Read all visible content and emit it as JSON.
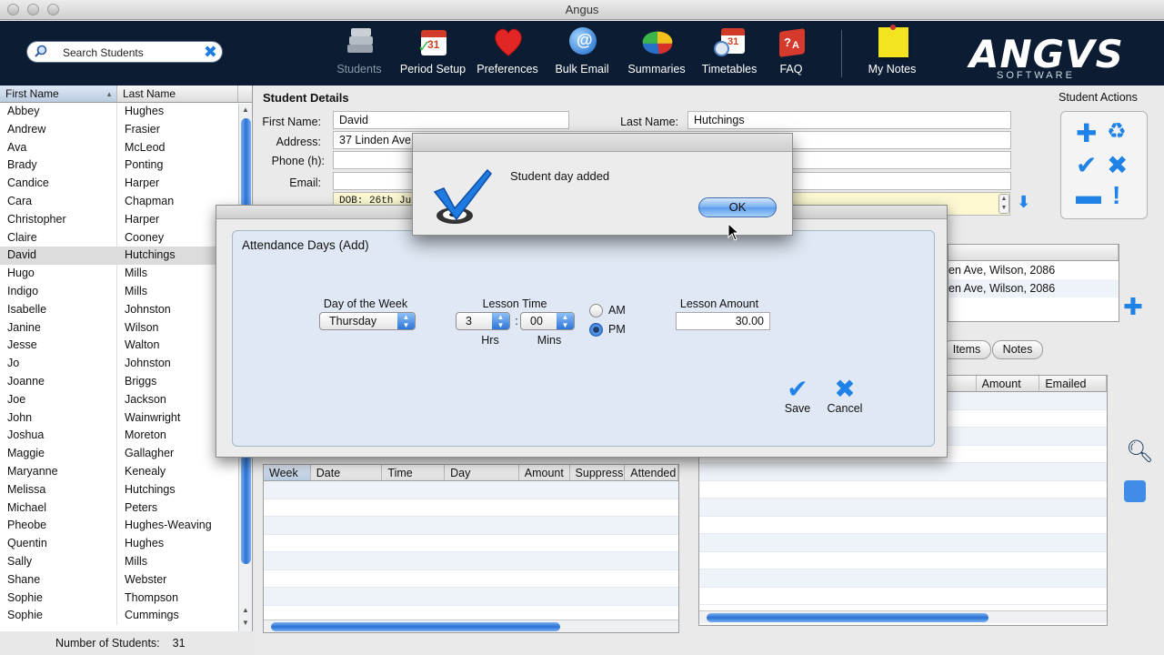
{
  "window": {
    "title": "Angus"
  },
  "toolbar": {
    "search_placeholder": "Search Students",
    "items": [
      {
        "label": "Students",
        "icon": "books-icon"
      },
      {
        "label": "Period Setup",
        "icon": "calendar-icon"
      },
      {
        "label": "Preferences",
        "icon": "heart-icon"
      },
      {
        "label": "Bulk Email",
        "icon": "email-globe-icon"
      },
      {
        "label": "Summaries",
        "icon": "pie-chart-icon"
      },
      {
        "label": "Timetables",
        "icon": "clock-calendar-icon"
      },
      {
        "label": "FAQ",
        "icon": "faq-icon"
      },
      {
        "label": "My Notes",
        "icon": "sticky-note-icon"
      }
    ],
    "logo_word": "ANGVS",
    "logo_sub": "SOFTWARE"
  },
  "list": {
    "headers": [
      "First Name",
      "Last Name"
    ],
    "selected": "David",
    "rows": [
      [
        "Abbey",
        "Hughes"
      ],
      [
        "Andrew",
        "Frasier"
      ],
      [
        "Ava",
        "McLeod"
      ],
      [
        "Brady",
        "Ponting"
      ],
      [
        "Candice",
        "Harper"
      ],
      [
        "Cara",
        "Chapman"
      ],
      [
        "Christopher",
        "Harper"
      ],
      [
        "Claire",
        "Cooney"
      ],
      [
        "David",
        "Hutchings"
      ],
      [
        "Hugo",
        "Mills"
      ],
      [
        "Indigo",
        "Mills"
      ],
      [
        "Isabelle",
        "Johnston"
      ],
      [
        "Janine",
        "Wilson"
      ],
      [
        "Jesse",
        "Walton"
      ],
      [
        "Jo",
        "Johnston"
      ],
      [
        "Joanne",
        "Briggs"
      ],
      [
        "Joe",
        "Jackson"
      ],
      [
        "John",
        "Wainwright"
      ],
      [
        "Joshua",
        "Moreton"
      ],
      [
        "Maggie",
        "Gallagher"
      ],
      [
        "Maryanne",
        "Kenealy"
      ],
      [
        "Melissa",
        "Hutchings"
      ],
      [
        "Michael",
        "Peters"
      ],
      [
        "Pheobe",
        "Hughes-Weaving"
      ],
      [
        "Quentin",
        "Hughes"
      ],
      [
        "Sally",
        "Mills"
      ],
      [
        "Shane",
        "Webster"
      ],
      [
        "Sophie",
        "Thompson"
      ],
      [
        "Sophie",
        "Cummings"
      ]
    ],
    "count_label": "Number of Students:",
    "count": "31"
  },
  "details": {
    "heading": "Student Details",
    "first_name_label": "First Name:",
    "first_name": "David",
    "last_name_label": "Last Name:",
    "last_name": "Hutchings",
    "address_label": "Address:",
    "address": "37 Linden Ave",
    "phone_label": "Phone (h):",
    "email_label": "Email:",
    "notes_partial": "DOB: 26th Ju",
    "address_rows": [
      "en Ave, Wilson, 2086",
      "en Ave, Wilson, 2086"
    ],
    "actions_title": "Student Actions"
  },
  "lower": {
    "tabs": [
      "Items",
      "Notes"
    ],
    "right_headers": [
      "Amount",
      "Emailed"
    ],
    "left_headers": [
      "Week",
      "Date",
      "Time",
      "Day",
      "Amount",
      "Suppress",
      "Attended"
    ]
  },
  "sheet": {
    "title": "Attendance Days (Add)",
    "day_label": "Day of the Week",
    "day_value": "Thursday",
    "time_label": "Lesson Time",
    "hours": "3",
    "minutes": "00",
    "hrs_label": "Hrs",
    "mins_label": "Mins",
    "am_label": "AM",
    "pm_label": "PM",
    "ampm_selected": "PM",
    "amount_label": "Lesson Amount",
    "amount_value": "30.00",
    "save_label": "Save",
    "cancel_label": "Cancel"
  },
  "alert": {
    "message": "Student day added",
    "ok_label": "OK"
  },
  "colors": {
    "toolbar_bg": "#0c1d33",
    "accent": "#1f82e6"
  }
}
